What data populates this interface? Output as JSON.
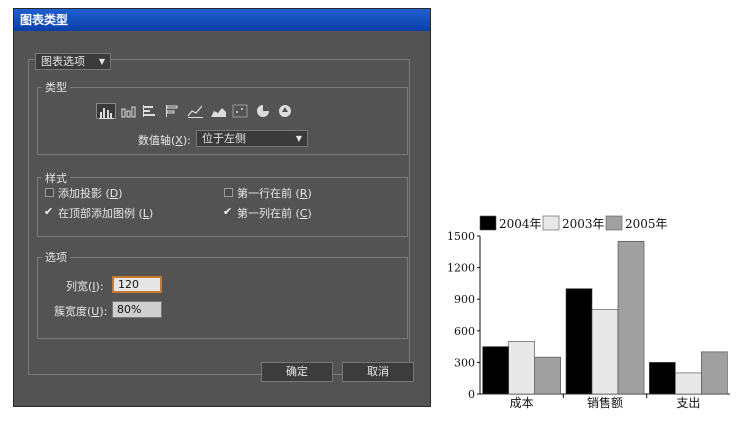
{
  "dialog": {
    "title": "图表类型",
    "options_menu": "图表选项",
    "type_group": {
      "label": "类型",
      "types": [
        {
          "name": "column-chart-icon",
          "selected": true
        },
        {
          "name": "stacked-column-chart-icon",
          "selected": false
        },
        {
          "name": "bar-chart-icon",
          "selected": false
        },
        {
          "name": "stacked-bar-chart-icon",
          "selected": false
        },
        {
          "name": "line-chart-icon",
          "selected": false
        },
        {
          "name": "area-chart-icon",
          "selected": false
        },
        {
          "name": "scatter-chart-icon",
          "selected": false
        },
        {
          "name": "pie-chart-icon",
          "selected": false
        },
        {
          "name": "radar-chart-icon",
          "selected": false
        }
      ],
      "value_axis_label": "数值轴",
      "value_axis_key": "X",
      "value_axis_value": "位于左侧"
    },
    "style_group": {
      "label": "样式",
      "options": [
        {
          "label": "添加投影",
          "key": "D",
          "checked": false
        },
        {
          "label": "第一行在前",
          "key": "R",
          "checked": false
        },
        {
          "label": "在顶部添加图例",
          "key": "L",
          "checked": true
        },
        {
          "label": "第一列在前",
          "key": "C",
          "checked": true
        }
      ]
    },
    "options_group": {
      "label": "选项",
      "column_width_label": "列宽",
      "column_width_key": "I",
      "column_width_value": "120",
      "cluster_width_label": "簇宽度",
      "cluster_width_key": "U",
      "cluster_width_value": "80%"
    },
    "ok_label": "确定",
    "cancel_label": "取消"
  },
  "chart_data": {
    "type": "bar",
    "categories": [
      "成本",
      "销售额",
      "支出"
    ],
    "series": [
      {
        "name": "2004年",
        "color": "#000000",
        "values": [
          450,
          1000,
          300
        ]
      },
      {
        "name": "2003年",
        "color": "#e8e8e8",
        "values": [
          500,
          800,
          200
        ]
      },
      {
        "name": "2005年",
        "color": "#a0a0a0",
        "values": [
          350,
          1450,
          400
        ]
      }
    ],
    "ylim": [
      0,
      1500
    ],
    "yticks": [
      0,
      300,
      600,
      900,
      1200,
      1500
    ],
    "legend": "top"
  }
}
